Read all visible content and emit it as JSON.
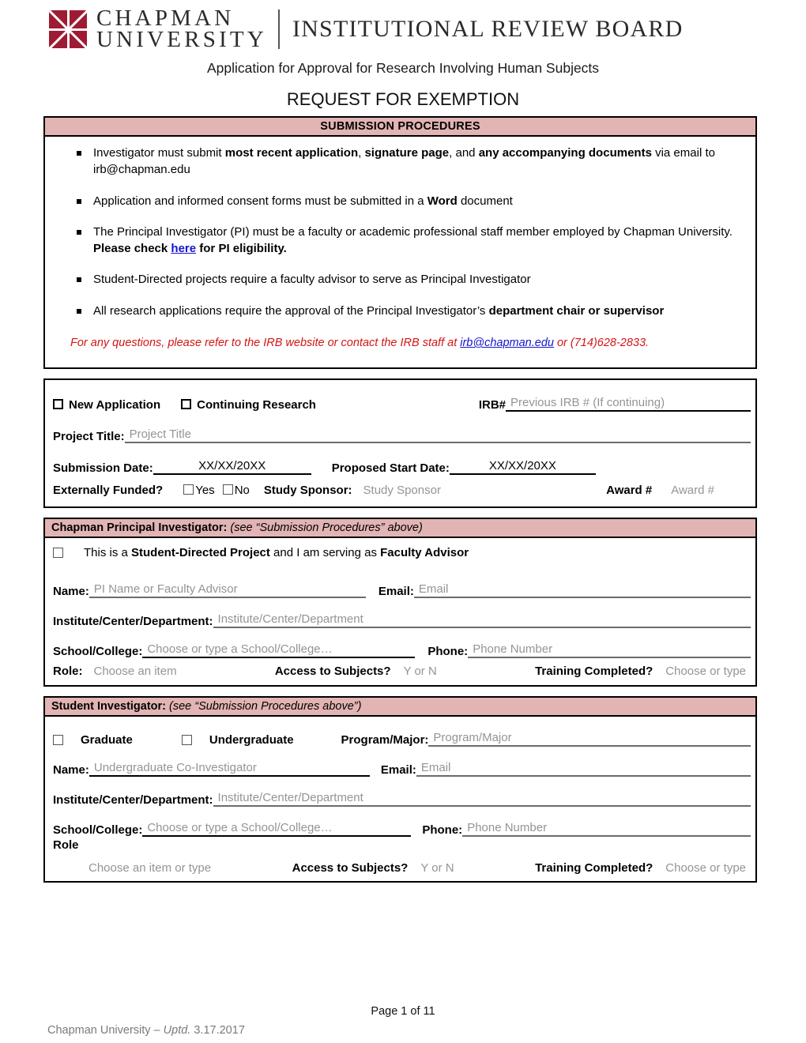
{
  "header": {
    "logo_line1": "CHAPMAN",
    "logo_line2": "UNIVERSITY",
    "logo_right": "INSTITUTIONAL REVIEW BOARD",
    "brand_color": "#9E1B34"
  },
  "titles": {
    "subtitle": "Application for Approval for Research Involving Human Subjects",
    "title": "REQUEST FOR EXEMPTION"
  },
  "submission": {
    "band": "SUBMISSION PROCEDURES",
    "band_color": "#E2B4B4",
    "bullets": [
      {
        "pre": "Investigator must submit ",
        "b1": "most recent application",
        "mid1": ", ",
        "b2": "signature page",
        "mid2": ", and ",
        "b3": "any accompanying documents",
        "post": " via email to irb@chapman.edu"
      },
      {
        "pre": "Application and informed consent forms must be submitted in a ",
        "b1": "Word",
        "post": " document"
      },
      {
        "pre": " The Principal Investigator (PI) must be a faculty or academic professional staff member employed by Chapman University. ",
        "b1": "Please check ",
        "link": "here",
        "post": " for PI eligibility."
      },
      {
        "pre": "Student-Directed projects require a faculty advisor to serve as Principal Investigator"
      },
      {
        "pre": "All research applications require the approval of the Principal Investigator’s ",
        "b1": "department chair or supervisor"
      }
    ],
    "note_pre": "For any questions, please refer to the IRB website or contact the IRB staff at ",
    "note_link": "irb@chapman.edu",
    "note_post": " or (714)628-2833."
  },
  "application": {
    "new_application_label": "New Application",
    "continuing_research_label": "Continuing Research",
    "irb_label": "IRB#",
    "irb_placeholder": "Previous IRB # (If continuing)",
    "project_title_label": "Project Title:",
    "project_title_placeholder": "Project Title",
    "submission_date_label": "Submission Date:",
    "submission_date_value": "XX/XX/20XX",
    "proposed_start_label": "Proposed Start Date:",
    "proposed_start_value": "XX/XX/20XX",
    "externally_funded_label": "Externally Funded?",
    "yes_label": "Yes",
    "no_label": "No",
    "study_sponsor_label": "Study Sponsor:",
    "study_sponsor_placeholder": "Study Sponsor",
    "award_label": "Award #",
    "award_placeholder": "Award #"
  },
  "pi": {
    "band_bold": "Chapman Principal Investigator:",
    "band_rest": " (see “Submission Procedures” above)",
    "student_directed_pre": "This is a ",
    "student_directed_b1": "Student-Directed Project",
    "student_directed_mid": " and I am serving as ",
    "student_directed_b2": "Faculty Advisor",
    "name_label": "Name:",
    "name_placeholder": "PI Name or Faculty Advisor",
    "email_label": "Email:",
    "email_placeholder": "Email",
    "dept_label": "Institute/Center/Department:",
    "dept_placeholder": "Institute/Center/Department",
    "school_label": "School/College:",
    "school_placeholder": "Choose or type a School/College…",
    "phone_label": "Phone:",
    "phone_placeholder": "Phone Number",
    "role_label": "Role:",
    "role_placeholder": "Choose an item",
    "access_label": "Access to Subjects?",
    "access_placeholder": "Y or N",
    "training_label": "Training Completed?",
    "training_placeholder": "Choose or type"
  },
  "student": {
    "band_bold": "Student Investigator:",
    "band_rest": " (see “Submission Procedures above”)",
    "graduate_label": "Graduate",
    "undergraduate_label": "Undergraduate",
    "program_label": "Program/Major:",
    "program_placeholder": "Program/Major",
    "name_label": "Name:",
    "name_placeholder": "Undergraduate Co-Investigator",
    "email_label": "Email:",
    "email_placeholder": "Email",
    "dept_label": "Institute/Center/Department:",
    "dept_placeholder": "Institute/Center/Department",
    "school_label": "School/College:",
    "school_placeholder": "Choose or type a School/College…",
    "phone_label": "Phone:",
    "phone_placeholder": "Phone Number",
    "role_label": "Role",
    "role_placeholder": "Choose an item or type",
    "access_label": "Access to Subjects?",
    "access_placeholder": "Y or N",
    "training_label": "Training Completed?",
    "training_placeholder": "Choose or type"
  },
  "footer": {
    "page_number": "Page 1 of 11",
    "org": "Chapman University – ",
    "uptd_italic": "Uptd.",
    "uptd_date": " 3.17.2017"
  }
}
